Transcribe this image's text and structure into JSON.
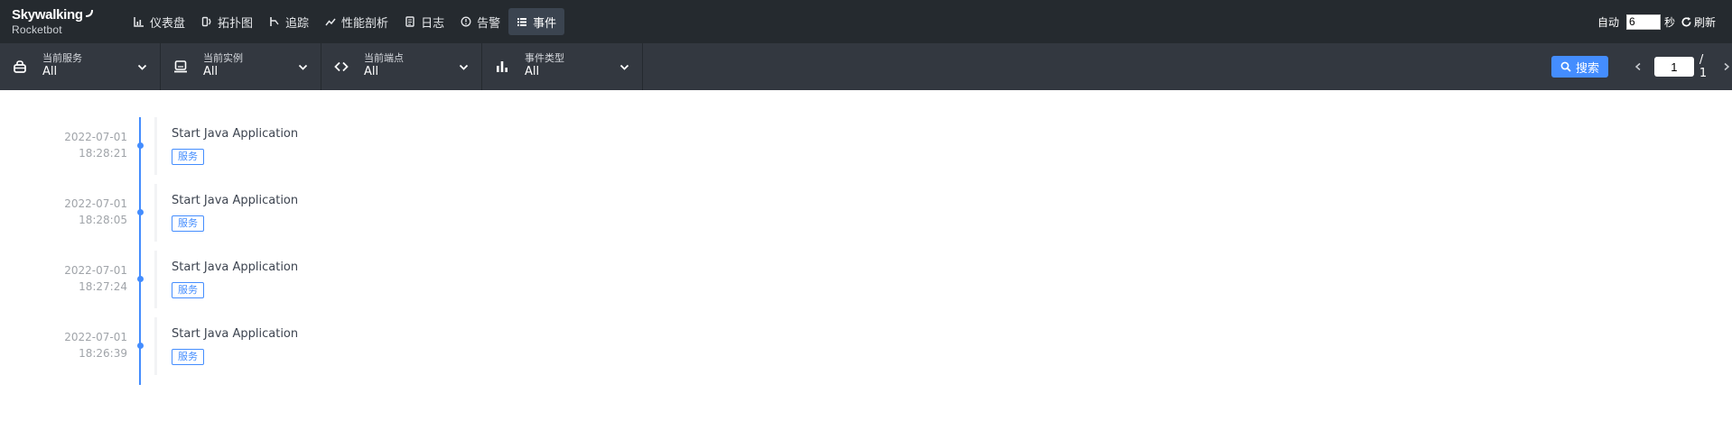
{
  "app": {
    "brand": "Skywalking",
    "subtitle": "Rocketbot"
  },
  "nav": [
    {
      "label": "仪表盘",
      "icon": "dashboard-icon"
    },
    {
      "label": "拓扑图",
      "icon": "topology-icon"
    },
    {
      "label": "追踪",
      "icon": "trace-icon"
    },
    {
      "label": "性能剖析",
      "icon": "profile-icon"
    },
    {
      "label": "日志",
      "icon": "log-icon"
    },
    {
      "label": "告警",
      "icon": "alarm-icon"
    },
    {
      "label": "事件",
      "icon": "event-icon",
      "active": true
    }
  ],
  "toolbar": {
    "auto_label": "自动",
    "auto_interval": "6",
    "seconds_label": "秒",
    "refresh_label": "刷新"
  },
  "filters": [
    {
      "label": "当前服务",
      "value": "All",
      "icon": "service-icon"
    },
    {
      "label": "当前实例",
      "value": "All",
      "icon": "instance-icon"
    },
    {
      "label": "当前端点",
      "value": "All",
      "icon": "endpoint-icon"
    },
    {
      "label": "事件类型",
      "value": "All",
      "icon": "event-type-icon"
    }
  ],
  "search": {
    "label": "搜索"
  },
  "pagination": {
    "current": "1",
    "total": "/ 1"
  },
  "events": [
    {
      "date": "2022-07-01",
      "time": "18:28:21",
      "title": "Start Java Application",
      "tag": "服务"
    },
    {
      "date": "2022-07-01",
      "time": "18:28:05",
      "title": "Start Java Application",
      "tag": "服务"
    },
    {
      "date": "2022-07-01",
      "time": "18:27:24",
      "title": "Start Java Application",
      "tag": "服务"
    },
    {
      "date": "2022-07-01",
      "time": "18:26:39",
      "title": "Start Java Application",
      "tag": "服务"
    }
  ],
  "colors": {
    "topbar": "#252a2f",
    "filterbar": "#333840",
    "accent": "#448dfe",
    "active_nav": "#3b4450"
  }
}
